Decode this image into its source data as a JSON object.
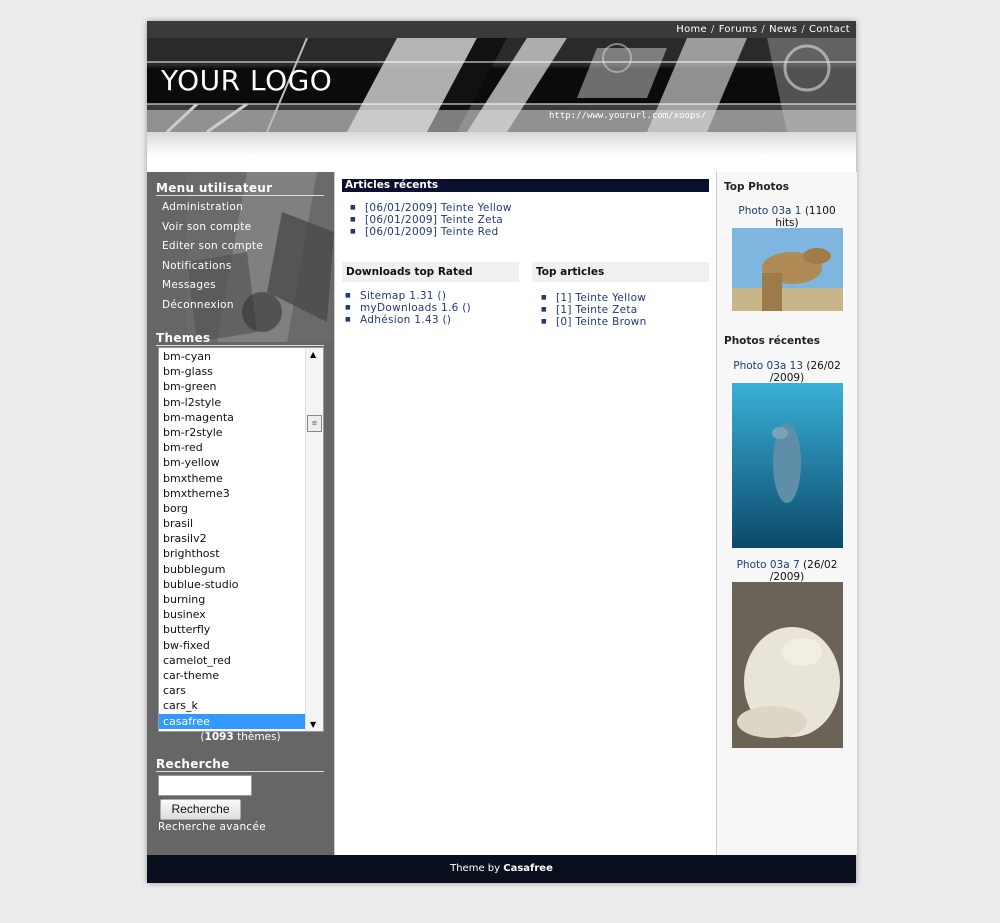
{
  "topnav": {
    "home": "Home",
    "forums": "Forums",
    "news": "News",
    "contact": "Contact",
    "separator": "/"
  },
  "header": {
    "logo": "YOUR LOGO",
    "url": "http://www.yoururl.com/xoops/"
  },
  "user_menu": {
    "title": "Menu utilisateur",
    "items": [
      "Administration",
      "Voir son compte",
      "Editer son compte",
      "Notifications",
      "Messages",
      "Déconnexion"
    ]
  },
  "themes": {
    "title": "Themes",
    "items": [
      "bm-cyan",
      "bm-glass",
      "bm-green",
      "bm-l2style",
      "bm-magenta",
      "bm-r2style",
      "bm-red",
      "bm-yellow",
      "bmxtheme",
      "bmxtheme3",
      "borg",
      "brasil",
      "brasilv2",
      "brighthost",
      "bubblegum",
      "bublue-studio",
      "burning",
      "businex",
      "butterfly",
      "bw-fixed",
      "camelot_red",
      "car-theme",
      "cars",
      "cars_k",
      "casafree"
    ],
    "selected": "casafree",
    "count_open": "(",
    "count_value": "1093",
    "count_label": "thèmes)"
  },
  "search": {
    "title": "Recherche",
    "value": "",
    "button": "Recherche",
    "advanced": "Recherche avancée"
  },
  "recent_articles": {
    "title": "Articles récents",
    "items": [
      "[06/01/2009] Teinte Yellow",
      "[06/01/2009] Teinte Zeta",
      "[06/01/2009] Teinte Red"
    ]
  },
  "downloads": {
    "title": "Downloads top Rated",
    "items": [
      "Sitemap 1.31 ()",
      "myDownloads 1.6 ()",
      "Adhésion 1.43 ()"
    ]
  },
  "top_articles": {
    "title": "Top articles",
    "items": [
      "[1] Teinte Yellow",
      "[1] Teinte Zeta",
      "[0] Teinte Brown"
    ]
  },
  "top_photos": {
    "title": "Top Photos",
    "photo1": {
      "link": "Photo 03a 1",
      "meta_line1": "(1100",
      "meta_line2": "hits)"
    }
  },
  "recent_photos": {
    "title": "Photos récentes",
    "photo1": {
      "link": "Photo 03a 13",
      "meta_line1": "(26/02",
      "meta_line2": "/2009)"
    },
    "photo2": {
      "link": "Photo 03a 7",
      "meta_line1": "(26/02",
      "meta_line2": "/2009)"
    }
  },
  "footer": {
    "prefix": "Theme by",
    "brand": "Casafree"
  },
  "colors": {
    "sidebar": "#666666",
    "title_bar": "#0a0f2e",
    "link": "#1f3a7a",
    "selected": "#3399ff"
  }
}
